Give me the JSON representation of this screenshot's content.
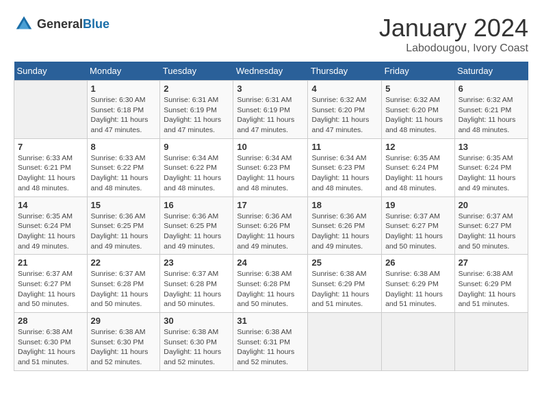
{
  "header": {
    "logo_general": "General",
    "logo_blue": "Blue",
    "title": "January 2024",
    "subtitle": "Labodougou, Ivory Coast"
  },
  "calendar": {
    "days_of_week": [
      "Sunday",
      "Monday",
      "Tuesday",
      "Wednesday",
      "Thursday",
      "Friday",
      "Saturday"
    ],
    "weeks": [
      [
        {
          "day": "",
          "sunrise": "",
          "sunset": "",
          "daylight": ""
        },
        {
          "day": "1",
          "sunrise": "Sunrise: 6:30 AM",
          "sunset": "Sunset: 6:18 PM",
          "daylight": "Daylight: 11 hours and 47 minutes."
        },
        {
          "day": "2",
          "sunrise": "Sunrise: 6:31 AM",
          "sunset": "Sunset: 6:19 PM",
          "daylight": "Daylight: 11 hours and 47 minutes."
        },
        {
          "day": "3",
          "sunrise": "Sunrise: 6:31 AM",
          "sunset": "Sunset: 6:19 PM",
          "daylight": "Daylight: 11 hours and 47 minutes."
        },
        {
          "day": "4",
          "sunrise": "Sunrise: 6:32 AM",
          "sunset": "Sunset: 6:20 PM",
          "daylight": "Daylight: 11 hours and 47 minutes."
        },
        {
          "day": "5",
          "sunrise": "Sunrise: 6:32 AM",
          "sunset": "Sunset: 6:20 PM",
          "daylight": "Daylight: 11 hours and 48 minutes."
        },
        {
          "day": "6",
          "sunrise": "Sunrise: 6:32 AM",
          "sunset": "Sunset: 6:21 PM",
          "daylight": "Daylight: 11 hours and 48 minutes."
        }
      ],
      [
        {
          "day": "7",
          "sunrise": "Sunrise: 6:33 AM",
          "sunset": "Sunset: 6:21 PM",
          "daylight": "Daylight: 11 hours and 48 minutes."
        },
        {
          "day": "8",
          "sunrise": "Sunrise: 6:33 AM",
          "sunset": "Sunset: 6:22 PM",
          "daylight": "Daylight: 11 hours and 48 minutes."
        },
        {
          "day": "9",
          "sunrise": "Sunrise: 6:34 AM",
          "sunset": "Sunset: 6:22 PM",
          "daylight": "Daylight: 11 hours and 48 minutes."
        },
        {
          "day": "10",
          "sunrise": "Sunrise: 6:34 AM",
          "sunset": "Sunset: 6:23 PM",
          "daylight": "Daylight: 11 hours and 48 minutes."
        },
        {
          "day": "11",
          "sunrise": "Sunrise: 6:34 AM",
          "sunset": "Sunset: 6:23 PM",
          "daylight": "Daylight: 11 hours and 48 minutes."
        },
        {
          "day": "12",
          "sunrise": "Sunrise: 6:35 AM",
          "sunset": "Sunset: 6:24 PM",
          "daylight": "Daylight: 11 hours and 48 minutes."
        },
        {
          "day": "13",
          "sunrise": "Sunrise: 6:35 AM",
          "sunset": "Sunset: 6:24 PM",
          "daylight": "Daylight: 11 hours and 49 minutes."
        }
      ],
      [
        {
          "day": "14",
          "sunrise": "Sunrise: 6:35 AM",
          "sunset": "Sunset: 6:24 PM",
          "daylight": "Daylight: 11 hours and 49 minutes."
        },
        {
          "day": "15",
          "sunrise": "Sunrise: 6:36 AM",
          "sunset": "Sunset: 6:25 PM",
          "daylight": "Daylight: 11 hours and 49 minutes."
        },
        {
          "day": "16",
          "sunrise": "Sunrise: 6:36 AM",
          "sunset": "Sunset: 6:25 PM",
          "daylight": "Daylight: 11 hours and 49 minutes."
        },
        {
          "day": "17",
          "sunrise": "Sunrise: 6:36 AM",
          "sunset": "Sunset: 6:26 PM",
          "daylight": "Daylight: 11 hours and 49 minutes."
        },
        {
          "day": "18",
          "sunrise": "Sunrise: 6:36 AM",
          "sunset": "Sunset: 6:26 PM",
          "daylight": "Daylight: 11 hours and 49 minutes."
        },
        {
          "day": "19",
          "sunrise": "Sunrise: 6:37 AM",
          "sunset": "Sunset: 6:27 PM",
          "daylight": "Daylight: 11 hours and 50 minutes."
        },
        {
          "day": "20",
          "sunrise": "Sunrise: 6:37 AM",
          "sunset": "Sunset: 6:27 PM",
          "daylight": "Daylight: 11 hours and 50 minutes."
        }
      ],
      [
        {
          "day": "21",
          "sunrise": "Sunrise: 6:37 AM",
          "sunset": "Sunset: 6:27 PM",
          "daylight": "Daylight: 11 hours and 50 minutes."
        },
        {
          "day": "22",
          "sunrise": "Sunrise: 6:37 AM",
          "sunset": "Sunset: 6:28 PM",
          "daylight": "Daylight: 11 hours and 50 minutes."
        },
        {
          "day": "23",
          "sunrise": "Sunrise: 6:37 AM",
          "sunset": "Sunset: 6:28 PM",
          "daylight": "Daylight: 11 hours and 50 minutes."
        },
        {
          "day": "24",
          "sunrise": "Sunrise: 6:38 AM",
          "sunset": "Sunset: 6:28 PM",
          "daylight": "Daylight: 11 hours and 50 minutes."
        },
        {
          "day": "25",
          "sunrise": "Sunrise: 6:38 AM",
          "sunset": "Sunset: 6:29 PM",
          "daylight": "Daylight: 11 hours and 51 minutes."
        },
        {
          "day": "26",
          "sunrise": "Sunrise: 6:38 AM",
          "sunset": "Sunset: 6:29 PM",
          "daylight": "Daylight: 11 hours and 51 minutes."
        },
        {
          "day": "27",
          "sunrise": "Sunrise: 6:38 AM",
          "sunset": "Sunset: 6:29 PM",
          "daylight": "Daylight: 11 hours and 51 minutes."
        }
      ],
      [
        {
          "day": "28",
          "sunrise": "Sunrise: 6:38 AM",
          "sunset": "Sunset: 6:30 PM",
          "daylight": "Daylight: 11 hours and 51 minutes."
        },
        {
          "day": "29",
          "sunrise": "Sunrise: 6:38 AM",
          "sunset": "Sunset: 6:30 PM",
          "daylight": "Daylight: 11 hours and 52 minutes."
        },
        {
          "day": "30",
          "sunrise": "Sunrise: 6:38 AM",
          "sunset": "Sunset: 6:30 PM",
          "daylight": "Daylight: 11 hours and 52 minutes."
        },
        {
          "day": "31",
          "sunrise": "Sunrise: 6:38 AM",
          "sunset": "Sunset: 6:31 PM",
          "daylight": "Daylight: 11 hours and 52 minutes."
        },
        {
          "day": "",
          "sunrise": "",
          "sunset": "",
          "daylight": ""
        },
        {
          "day": "",
          "sunrise": "",
          "sunset": "",
          "daylight": ""
        },
        {
          "day": "",
          "sunrise": "",
          "sunset": "",
          "daylight": ""
        }
      ]
    ]
  }
}
